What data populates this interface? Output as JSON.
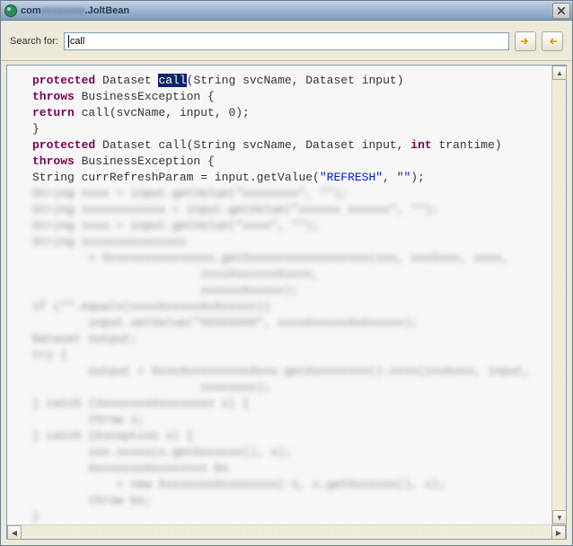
{
  "titlebar": {
    "prefix": "com",
    "blurred_mid": "xxxxxxxx",
    "suffix": "JoltBean"
  },
  "toolbar": {
    "search_label": "Search for:",
    "search_value": "call"
  },
  "code": {
    "lines": [
      {
        "indent": 0,
        "tokens": [
          {
            "t": "protected",
            "c": "kw"
          },
          {
            "t": " Dataset ",
            "c": ""
          },
          {
            "t": "call",
            "c": "hl"
          },
          {
            "t": "(String svcName, Dataset input)",
            "c": ""
          }
        ],
        "blurred": false
      },
      {
        "indent": 0,
        "tokens": [
          {
            "t": "throws",
            "c": "kw"
          },
          {
            "t": " BusinessException {",
            "c": ""
          }
        ],
        "blurred": false
      },
      {
        "indent": 0,
        "tokens": [
          {
            "t": "return",
            "c": "kw"
          },
          {
            "t": " call(svcName, input, 0);",
            "c": ""
          }
        ],
        "blurred": false
      },
      {
        "indent": 0,
        "tokens": [
          {
            "t": "}",
            "c": ""
          }
        ],
        "blurred": false
      },
      {
        "indent": 0,
        "tokens": [
          {
            "t": "",
            "c": ""
          }
        ],
        "blurred": false
      },
      {
        "indent": 0,
        "tokens": [
          {
            "t": "protected",
            "c": "kw"
          },
          {
            "t": " Dataset call(String svcName, Dataset input, ",
            "c": ""
          },
          {
            "t": "int",
            "c": "kw"
          },
          {
            "t": " trantime)",
            "c": ""
          }
        ],
        "blurred": false
      },
      {
        "indent": 0,
        "tokens": [
          {
            "t": "throws",
            "c": "kw"
          },
          {
            "t": " BusinessException {",
            "c": ""
          }
        ],
        "blurred": false
      },
      {
        "indent": 0,
        "tokens": [
          {
            "t": "String currRefreshParam = input.getValue(",
            "c": ""
          },
          {
            "t": "\"REFRESH\"",
            "c": "str"
          },
          {
            "t": ", ",
            "c": ""
          },
          {
            "t": "\"\"",
            "c": "str"
          },
          {
            "t": ");",
            "c": ""
          }
        ],
        "blurred": false
      },
      {
        "indent": 0,
        "tokens": [
          {
            "t": "String xxxx = input.getValue(\"xxxxxxxx\", \"\");",
            "c": ""
          }
        ],
        "blurred": true
      },
      {
        "indent": 0,
        "tokens": [
          {
            "t": "String xxxxxxxxxxxx = input.getValue(\"xxxxxx xxxxxx\", \"\");",
            "c": ""
          }
        ],
        "blurred": true
      },
      {
        "indent": 0,
        "tokens": [
          {
            "t": "String xxxx = input.getValue(\"xxxx\", \"\");",
            "c": ""
          }
        ],
        "blurred": true
      },
      {
        "indent": 0,
        "tokens": [
          {
            "t": "String xxxxxxxxxxxxxxx",
            "c": ""
          }
        ],
        "blurred": true
      },
      {
        "indent": 2,
        "tokens": [
          {
            "t": "= Xxxxxxxxxxxxxxxx.getXxxxxxxxxxxxxxxxxx(xxx, xxxXxxx, xxxx,",
            "c": ""
          }
        ],
        "blurred": true
      },
      {
        "indent": 6,
        "tokens": [
          {
            "t": "xxxxXxxxxxxXxxxx,",
            "c": ""
          }
        ],
        "blurred": true
      },
      {
        "indent": 6,
        "tokens": [
          {
            "t": "xxxxxxXxxxxx);",
            "c": ""
          }
        ],
        "blurred": true
      },
      {
        "indent": 0,
        "tokens": [
          {
            "t": "if (\"\".equals(xxxxXxxxxxXxXxxxxx))",
            "c": ""
          }
        ],
        "blurred": true
      },
      {
        "indent": 2,
        "tokens": [
          {
            "t": "input.setValue(\"XXXXXXXX\", xxxxXxxxxxXxXxxxxx);",
            "c": ""
          }
        ],
        "blurred": true
      },
      {
        "indent": 0,
        "tokens": [
          {
            "t": "Dataset output;",
            "c": ""
          }
        ],
        "blurred": true
      },
      {
        "indent": 0,
        "tokens": [
          {
            "t": "try {",
            "c": ""
          }
        ],
        "blurred": true
      },
      {
        "indent": 2,
        "tokens": [
          {
            "t": "output = XxxxXxxxxxxxxxXxxx.getXxxxxxxxx().xxxx(xxxXxxx, input,",
            "c": ""
          }
        ],
        "blurred": true
      },
      {
        "indent": 6,
        "tokens": [
          {
            "t": "xxxxxxxx);",
            "c": ""
          }
        ],
        "blurred": true
      },
      {
        "indent": 0,
        "tokens": [
          {
            "t": "} catch (XxxxxxxxXxxxxxxxx x) {",
            "c": ""
          }
        ],
        "blurred": true
      },
      {
        "indent": 2,
        "tokens": [
          {
            "t": "throw x;",
            "c": ""
          }
        ],
        "blurred": true
      },
      {
        "indent": 0,
        "tokens": [
          {
            "t": "} catch (Exception x) {",
            "c": ""
          }
        ],
        "blurred": true
      },
      {
        "indent": 2,
        "tokens": [
          {
            "t": "xxx.xxxxx(x.getXxxxxxx(), x);",
            "c": ""
          }
        ],
        "blurred": true
      },
      {
        "indent": 2,
        "tokens": [
          {
            "t": "XxxxxxxxXxxxxxxxx bx",
            "c": ""
          }
        ],
        "blurred": true
      },
      {
        "indent": 3,
        "tokens": [
          {
            "t": "= new XxxxxxxxXxxxxxxxx(-1, x.getXxxxxxx(), x);",
            "c": ""
          }
        ],
        "blurred": true
      },
      {
        "indent": 2,
        "tokens": [
          {
            "t": "throw bx;",
            "c": ""
          }
        ],
        "blurred": true
      },
      {
        "indent": 0,
        "tokens": [
          {
            "t": "}",
            "c": ""
          }
        ],
        "blurred": true
      }
    ]
  }
}
